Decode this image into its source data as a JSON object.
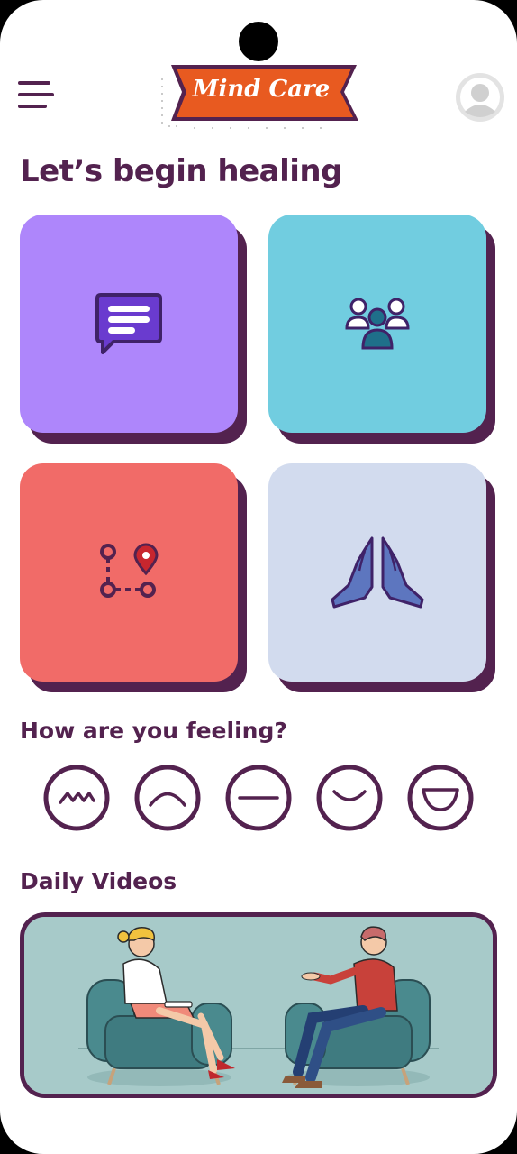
{
  "app": {
    "logo_text": "Mind Care"
  },
  "header": {
    "menu_icon": "hamburger-menu-icon",
    "profile_icon": "user-avatar-icon"
  },
  "main": {
    "greeting": "Let’s begin healing",
    "tiles": [
      {
        "icon": "chat-bubble-icon",
        "color": "#ae86fb"
      },
      {
        "icon": "group-people-icon",
        "color": "#71cde0"
      },
      {
        "icon": "route-map-pin-icon",
        "color": "#f16b68"
      },
      {
        "icon": "praying-hands-icon",
        "color": "#d2dbee"
      }
    ],
    "tile_shadow_color": "#53224f"
  },
  "mood": {
    "title": "How are you feeling?",
    "options": [
      {
        "icon": "zigzag-face-icon"
      },
      {
        "icon": "frown-face-icon"
      },
      {
        "icon": "neutral-face-icon"
      },
      {
        "icon": "smile-face-icon"
      },
      {
        "icon": "grin-face-icon"
      }
    ]
  },
  "videos": {
    "title": "Daily Videos",
    "thumbnail": "therapy-session-illustration"
  },
  "colors": {
    "primary": "#53224f",
    "logo_banner": "#e85a20",
    "background": "#ffffff"
  }
}
